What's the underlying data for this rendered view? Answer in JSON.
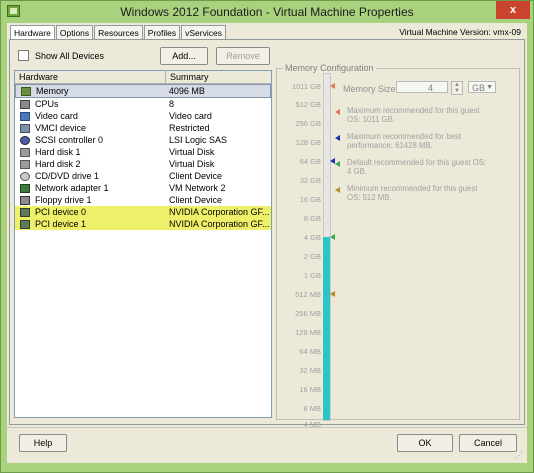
{
  "window": {
    "title": "Windows 2012 Foundation - Virtual Machine Properties",
    "close": "x"
  },
  "tabs": [
    {
      "label": "Hardware"
    },
    {
      "label": "Options"
    },
    {
      "label": "Resources"
    },
    {
      "label": "Profiles"
    },
    {
      "label": "vServices"
    }
  ],
  "vm_version": "Virtual Machine Version: vmx-09",
  "toolbar": {
    "show_all_devices": "Show All Devices",
    "add": "Add...",
    "remove": "Remove"
  },
  "hardware_table": {
    "headers": [
      "Hardware",
      "Summary"
    ],
    "rows": [
      {
        "name": "Memory",
        "summary": "4096 MB",
        "icon": "memory-icon"
      },
      {
        "name": "CPUs",
        "summary": "8",
        "icon": "cpu-icon"
      },
      {
        "name": "Video card",
        "summary": "Video card",
        "icon": "monitor-icon"
      },
      {
        "name": "VMCI device",
        "summary": "Restricted",
        "icon": "vmci-icon"
      },
      {
        "name": "SCSI controller 0",
        "summary": "LSI Logic SAS",
        "icon": "scsi-icon"
      },
      {
        "name": "Hard disk 1",
        "summary": "Virtual Disk",
        "icon": "disk-icon"
      },
      {
        "name": "Hard disk 2",
        "summary": "Virtual Disk",
        "icon": "disk-icon"
      },
      {
        "name": "CD/DVD drive 1",
        "summary": "Client Device",
        "icon": "cdrom-icon"
      },
      {
        "name": "Network adapter 1",
        "summary": "VM Network 2",
        "icon": "network-icon"
      },
      {
        "name": "Floppy drive 1",
        "summary": "Client Device",
        "icon": "floppy-icon"
      },
      {
        "name": "PCI device 0",
        "summary": "NVIDIA Corporation GF...",
        "icon": "pci-icon"
      },
      {
        "name": "PCI device 1",
        "summary": "NVIDIA Corporation GF...",
        "icon": "pci-icon"
      }
    ]
  },
  "memory_config": {
    "group_label": "Memory Configuration",
    "size_label": "Memory Size:",
    "size_value": "4",
    "unit": "GB",
    "scale_labels": [
      "1011 GB",
      "512 GB",
      "256 GB",
      "128 GB",
      "64 GB",
      "32 GB",
      "16 GB",
      "8 GB",
      "4 GB",
      "2 GB",
      "1 GB",
      "512 MB",
      "256 MB",
      "128 MB",
      "64 MB",
      "32 MB",
      "16 MB",
      "8 MB",
      "4 MB"
    ],
    "legend": [
      {
        "text": "Maximum recommended for this guest OS: 1011 GB.",
        "color": "#e07a5a"
      },
      {
        "text": "Maximum recommended for best performance: 61428 MB.",
        "color": "#1a2fbf"
      },
      {
        "text": "Default recommended for this guest OS: 4 GB.",
        "color": "#3aa84b"
      },
      {
        "text": "Minimum recommended for this guest OS: 512 MB.",
        "color": "#b08a30"
      }
    ]
  },
  "footer": {
    "help": "Help",
    "ok": "OK",
    "cancel": "Cancel"
  },
  "colors": {
    "highlight": "#eef06a",
    "bar": "#2bc4c8",
    "frame": "#a9d27e"
  }
}
